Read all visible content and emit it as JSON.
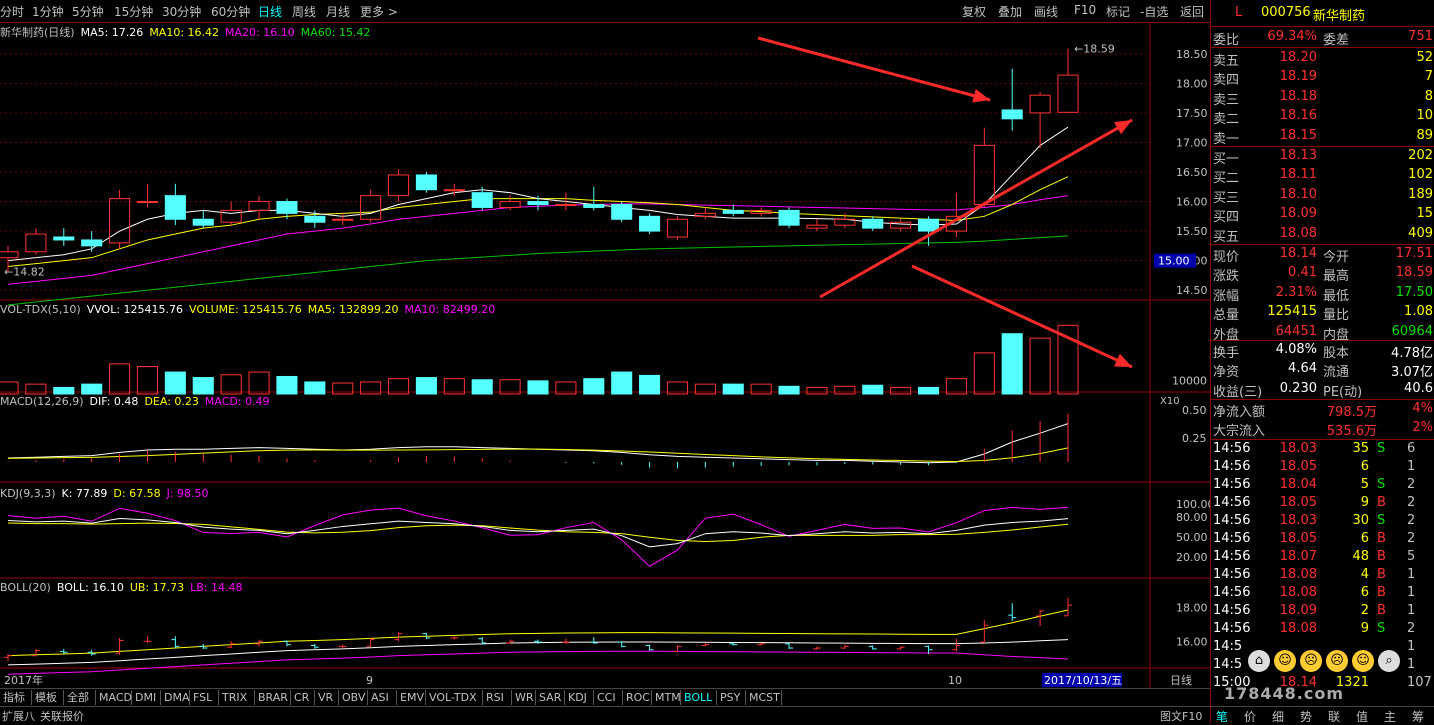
{
  "toolbar": {
    "timeframes": [
      "分时",
      "1分钟",
      "5分钟",
      "15分钟",
      "30分钟",
      "60分钟",
      "日线",
      "周线",
      "月线",
      "更多 >"
    ],
    "active_timeframe": "日线",
    "buttons": [
      "复权",
      "叠加",
      "画线",
      "F10",
      "标记",
      "-自选",
      "返回"
    ]
  },
  "chart_info": {
    "price_line": {
      "name": "新华制药(日线)",
      "ma5": "MA5: 17.26",
      "ma10": "MA10: 16.42",
      "ma20": "MA20: 16.10",
      "ma60": "MA60: 15.42"
    },
    "vol_line": {
      "name": "VOL-TDX(5,10)",
      "vvol": "VVOL: 125415.76",
      "volume": "VOLUME: 125415.76",
      "ma5": "MA5: 132899.20",
      "ma10": "MA10: 82499.20"
    },
    "macd_line": {
      "name": "MACD(12,26,9)",
      "dif": "DIF: 0.48",
      "dea": "DEA: 0.23",
      "macd": "MACD: 0.49"
    },
    "kdj_line": {
      "name": "KDJ(9,3,3)",
      "k": "K: 77.89",
      "d": "D: 67.58",
      "j": "J: 98.50"
    },
    "boll_line": {
      "name": "BOLL(20)",
      "boll": "BOLL: 16.10",
      "ub": "UB: 17.73",
      "lb": "LB: 14.48"
    },
    "high_marker": "18.59",
    "low_marker": "14.82",
    "current_price_tag": "15.00",
    "price_axis": [
      "18.50",
      "18.00",
      "17.50",
      "17.00",
      "16.50",
      "16.00",
      "15.50",
      "15.00",
      "14.50"
    ],
    "vol_axis": [
      "10000",
      "X10"
    ],
    "macd_axis": [
      "0.50",
      "0.25"
    ],
    "kdj_axis": [
      "100.00",
      "80.00",
      "50.00",
      "20.00"
    ],
    "boll_axis": [
      "18.00",
      "16.00"
    ],
    "date_axis": [
      "2017年",
      "9",
      "10"
    ],
    "cursor_date": "2017/10/13/五",
    "period_label": "日线"
  },
  "bottom_tabs": [
    "指标",
    "模板",
    "全部",
    "MACD",
    "DMI",
    "DMA",
    "FSL",
    "TRIX",
    "BRAR",
    "CR",
    "VR",
    "OBV",
    "ASI",
    "EMV",
    "VOL-TDX",
    "RSI",
    "WR",
    "SAR",
    "KDJ",
    "CCI",
    "ROC",
    "MTM",
    "BOLL",
    "PSY",
    "MCST"
  ],
  "bottom_active": "BOLL",
  "footer": {
    "expand": "扩展八",
    "related": "关联报价",
    "f10": "图文F10"
  },
  "right_panel": {
    "code": "000756",
    "name": "新华制药",
    "flag": "L",
    "weibi_label": "委比",
    "weibi": "69.34%",
    "weicha_label": "委差",
    "weicha": "751",
    "asks": [
      {
        "l": "卖五",
        "p": "18.20",
        "v": "52"
      },
      {
        "l": "卖四",
        "p": "18.19",
        "v": "7"
      },
      {
        "l": "卖三",
        "p": "18.18",
        "v": "8"
      },
      {
        "l": "卖二",
        "p": "18.16",
        "v": "10"
      },
      {
        "l": "卖一",
        "p": "18.15",
        "v": "89"
      }
    ],
    "bids": [
      {
        "l": "买一",
        "p": "18.13",
        "v": "202"
      },
      {
        "l": "买二",
        "p": "18.11",
        "v": "102"
      },
      {
        "l": "买三",
        "p": "18.10",
        "v": "189"
      },
      {
        "l": "买四",
        "p": "18.09",
        "v": "15"
      },
      {
        "l": "买五",
        "p": "18.08",
        "v": "409"
      }
    ],
    "stats": [
      {
        "l1": "现价",
        "v1": "18.14",
        "l2": "今开",
        "v2": "17.51"
      },
      {
        "l1": "涨跌",
        "v1": "0.41",
        "l2": "最高",
        "v2": "18.59"
      },
      {
        "l1": "涨幅",
        "v1": "2.31%",
        "l2": "最低",
        "v2": "17.50"
      },
      {
        "l1": "总量",
        "v1": "125415",
        "l2": "量比",
        "v2": "1.08"
      },
      {
        "l1": "外盘",
        "v1": "64451",
        "l2": "内盘",
        "v2": "60964"
      }
    ],
    "stats2": [
      {
        "l1": "换手",
        "v1": "4.08%",
        "l2": "股本",
        "v2": "4.78亿"
      },
      {
        "l1": "净资",
        "v1": "4.64",
        "l2": "流通",
        "v2": "3.07亿"
      },
      {
        "l1": "收益(三)",
        "v1": "0.230",
        "l2": "PE(动)",
        "v2": "40.6"
      }
    ],
    "flows": [
      {
        "l": "净流入额",
        "v": "798.5万",
        "p": "4%"
      },
      {
        "l": "大宗流入",
        "v": "535.6万",
        "p": "2%"
      }
    ],
    "ticks": [
      {
        "t": "14:56",
        "p": "18.03",
        "v": "35",
        "s": "S",
        "n": "6"
      },
      {
        "t": "14:56",
        "p": "18.05",
        "v": "6",
        "s": "",
        "n": "1"
      },
      {
        "t": "14:56",
        "p": "18.04",
        "v": "5",
        "s": "S",
        "n": "2"
      },
      {
        "t": "14:56",
        "p": "18.05",
        "v": "9",
        "s": "B",
        "n": "2"
      },
      {
        "t": "14:56",
        "p": "18.03",
        "v": "30",
        "s": "S",
        "n": "2"
      },
      {
        "t": "14:56",
        "p": "18.05",
        "v": "6",
        "s": "B",
        "n": "2"
      },
      {
        "t": "14:56",
        "p": "18.07",
        "v": "48",
        "s": "B",
        "n": "5"
      },
      {
        "t": "14:56",
        "p": "18.08",
        "v": "4",
        "s": "B",
        "n": "1"
      },
      {
        "t": "14:56",
        "p": "18.08",
        "v": "6",
        "s": "B",
        "n": "1"
      },
      {
        "t": "14:56",
        "p": "18.09",
        "v": "2",
        "s": "B",
        "n": "1"
      },
      {
        "t": "14:56",
        "p": "18.08",
        "v": "9",
        "s": "S",
        "n": "2"
      },
      {
        "t": "14:5",
        "p": "",
        "v": "",
        "s": "",
        "n": "1"
      },
      {
        "t": "14:5",
        "p": "",
        "v": "",
        "s": "",
        "n": "1"
      },
      {
        "t": "15:00",
        "p": "18.14",
        "v": "1321",
        "s": "",
        "n": "107"
      }
    ],
    "bottom_tabs": [
      "笔",
      "价",
      "细",
      "势",
      "联",
      "值",
      "主",
      "筹"
    ],
    "watermark": "178448.com"
  },
  "chart_data": {
    "type": "candlestick",
    "title": "新华制药(日线)",
    "candles": [
      [
        15.05,
        15.15,
        15.25,
        14.82
      ],
      [
        15.15,
        15.45,
        15.55,
        15.1
      ],
      [
        15.4,
        15.35,
        15.55,
        15.25
      ],
      [
        15.35,
        15.25,
        15.5,
        15.15
      ],
      [
        15.3,
        16.05,
        16.2,
        15.2
      ],
      [
        16.0,
        16.0,
        16.3,
        15.9
      ],
      [
        16.1,
        15.7,
        16.3,
        15.6
      ],
      [
        15.7,
        15.6,
        15.85,
        15.55
      ],
      [
        15.65,
        15.85,
        16.0,
        15.6
      ],
      [
        15.85,
        16.0,
        16.1,
        15.7
      ],
      [
        16.0,
        15.8,
        16.05,
        15.7
      ],
      [
        15.75,
        15.65,
        15.85,
        15.55
      ],
      [
        15.7,
        15.7,
        15.8,
        15.6
      ],
      [
        15.7,
        16.1,
        16.2,
        15.65
      ],
      [
        16.1,
        16.45,
        16.55,
        16.0
      ],
      [
        16.45,
        16.2,
        16.5,
        16.15
      ],
      [
        16.2,
        16.2,
        16.3,
        16.1
      ],
      [
        16.15,
        15.9,
        16.25,
        15.85
      ],
      [
        15.9,
        16.0,
        16.1,
        15.85
      ],
      [
        16.0,
        15.95,
        16.1,
        15.85
      ],
      [
        15.95,
        15.95,
        16.15,
        15.85
      ],
      [
        15.95,
        15.9,
        16.25,
        15.85
      ],
      [
        15.95,
        15.7,
        16.0,
        15.65
      ],
      [
        15.75,
        15.5,
        15.8,
        15.45
      ],
      [
        15.4,
        15.7,
        15.75,
        15.35
      ],
      [
        15.75,
        15.8,
        15.9,
        15.7
      ],
      [
        15.85,
        15.8,
        15.95,
        15.75
      ],
      [
        15.8,
        15.85,
        15.9,
        15.75
      ],
      [
        15.85,
        15.6,
        15.9,
        15.55
      ],
      [
        15.55,
        15.6,
        15.7,
        15.5
      ],
      [
        15.6,
        15.7,
        15.8,
        15.55
      ],
      [
        15.7,
        15.55,
        15.75,
        15.5
      ],
      [
        15.55,
        15.65,
        15.7,
        15.5
      ],
      [
        15.7,
        15.5,
        15.75,
        15.25
      ],
      [
        15.5,
        15.75,
        16.15,
        15.4
      ],
      [
        15.95,
        16.95,
        17.25,
        15.9
      ],
      [
        17.55,
        17.4,
        18.25,
        17.2
      ],
      [
        17.5,
        17.8,
        17.85,
        16.9
      ],
      [
        17.51,
        18.14,
        18.59,
        17.5
      ]
    ],
    "volume": [
      22000,
      18000,
      12000,
      18000,
      55000,
      50000,
      40000,
      30000,
      35000,
      40000,
      32000,
      22000,
      20000,
      22000,
      28000,
      30000,
      28000,
      26000,
      26000,
      24000,
      22000,
      28000,
      40000,
      34000,
      22000,
      18000,
      18000,
      18000,
      14000,
      12000,
      14000,
      16000,
      12000,
      12000,
      28000,
      75000,
      110000,
      102000,
      125415
    ],
    "ma5": [
      15.0,
      15.05,
      15.1,
      15.2,
      15.5,
      15.7,
      15.8,
      15.85,
      15.8,
      15.85,
      15.85,
      15.8,
      15.75,
      15.8,
      15.95,
      16.05,
      16.15,
      16.2,
      16.15,
      16.05,
      16.0,
      15.95,
      15.9,
      15.85,
      15.78,
      15.75,
      15.72,
      15.72,
      15.72,
      15.71,
      15.7,
      15.65,
      15.62,
      15.6,
      15.62,
      15.95,
      16.45,
      16.95,
      17.26
    ],
    "ma10": [
      14.9,
      14.95,
      15.0,
      15.05,
      15.2,
      15.35,
      15.45,
      15.55,
      15.6,
      15.7,
      15.75,
      15.78,
      15.8,
      15.82,
      15.9,
      15.95,
      16.0,
      16.05,
      16.05,
      16.05,
      16.05,
      16.02,
      16.0,
      15.98,
      15.95,
      15.9,
      15.85,
      15.83,
      15.8,
      15.78,
      15.76,
      15.74,
      15.72,
      15.7,
      15.68,
      15.75,
      15.95,
      16.2,
      16.42
    ],
    "ma20": [
      14.6,
      14.65,
      14.7,
      14.75,
      14.85,
      14.95,
      15.05,
      15.15,
      15.25,
      15.35,
      15.45,
      15.5,
      15.55,
      15.62,
      15.7,
      15.75,
      15.8,
      15.85,
      15.9,
      15.92,
      15.94,
      15.95,
      15.96,
      15.96,
      15.95,
      15.94,
      15.93,
      15.92,
      15.91,
      15.9,
      15.89,
      15.88,
      15.87,
      15.86,
      15.86,
      15.9,
      15.95,
      16.03,
      16.1
    ],
    "ma60": [
      14.25,
      14.3,
      14.35,
      14.4,
      14.45,
      14.5,
      14.55,
      14.6,
      14.65,
      14.7,
      14.75,
      14.8,
      14.85,
      14.9,
      14.95,
      15.0,
      15.03,
      15.06,
      15.09,
      15.12,
      15.14,
      15.16,
      15.18,
      15.2,
      15.21,
      15.22,
      15.23,
      15.24,
      15.25,
      15.26,
      15.27,
      15.28,
      15.29,
      15.3,
      15.31,
      15.33,
      15.36,
      15.39,
      15.42
    ],
    "ylim": [
      14.3,
      18.7
    ],
    "xlabel": "",
    "ylabel": ""
  },
  "colors": {
    "up": "#ff3232",
    "down": "#54ffff",
    "ma5": "#ffffff",
    "ma10": "#ffff00",
    "ma20": "#ff00ff",
    "ma60": "#00c000",
    "grid": "#800000"
  }
}
